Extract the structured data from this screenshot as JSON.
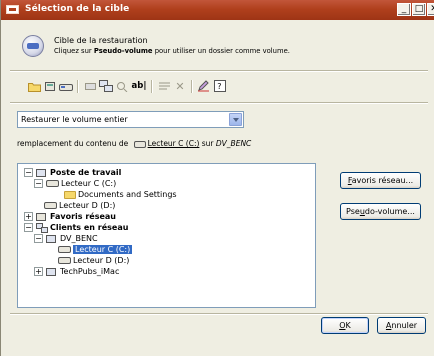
{
  "window": {
    "title": "Sélection de la cible",
    "icon": "window-icon",
    "controls": [
      "minimize",
      "maximize",
      "close"
    ]
  },
  "header": {
    "title": "Cible de la restauration",
    "subtitle_prefix": "Cliquez sur ",
    "subtitle_bold": "Pseudo-volume",
    "subtitle_suffix": " pour utiliser un dossier comme volume."
  },
  "toolbar": {
    "tools": [
      {
        "name": "new-folder-icon",
        "glyph": "📁",
        "enabled": true
      },
      {
        "name": "properties-icon",
        "glyph": "🗂",
        "enabled": true
      },
      {
        "name": "drive-icon",
        "glyph": "🖴",
        "enabled": true
      },
      {
        "name": "map-drive-icon",
        "glyph": "▭",
        "enabled": false
      },
      {
        "name": "network-icon",
        "glyph": "🖧",
        "enabled": true
      },
      {
        "name": "find-icon",
        "glyph": "🔍",
        "enabled": false
      },
      {
        "name": "rename-icon",
        "glyph": "ab|",
        "enabled": true
      },
      {
        "name": "view-icon",
        "glyph": "≡",
        "enabled": false
      },
      {
        "name": "delete-icon",
        "glyph": "✕",
        "enabled": false
      },
      {
        "name": "edit-icon",
        "glyph": "✎",
        "enabled": true
      },
      {
        "name": "help-icon",
        "glyph": "?",
        "enabled": true
      }
    ]
  },
  "restore_mode": {
    "selected": "Restaurer le volume entier"
  },
  "replacement": {
    "prefix": "remplacement du contenu de ",
    "drive": "Lecteur C (C:)",
    "middle": " sur ",
    "machine": "DV_BENC"
  },
  "tree": {
    "nodes": [
      {
        "label": "Poste de travail",
        "expander": "−",
        "bold": true
      },
      {
        "label": "Lecteur C (C:)",
        "expander": "−",
        "bold": false
      },
      {
        "label": "Documents and Settings",
        "expander": "",
        "bold": false
      },
      {
        "label": "Lecteur D (D:)",
        "expander": "",
        "bold": false
      },
      {
        "label": "Favoris réseau",
        "expander": "+",
        "bold": true
      },
      {
        "label": "Clients en réseau",
        "expander": "−",
        "bold": true
      },
      {
        "label": "DV_BENC",
        "expander": "−",
        "bold": false
      },
      {
        "label": "Lecteur C (C:)",
        "expander": "",
        "bold": false,
        "selected": true
      },
      {
        "label": "Lecteur D (D:)",
        "expander": "",
        "bold": false
      },
      {
        "label": "TechPubs_iMac",
        "expander": "+",
        "bold": false
      }
    ]
  },
  "side_buttons": {
    "favorites": {
      "label_pre": "",
      "label_u": "F",
      "label_post": "avoris réseau..."
    },
    "pseudo_volume": {
      "label_pre": "Pse",
      "label_u": "u",
      "label_post": "do-volume..."
    }
  },
  "footer_buttons": {
    "ok": {
      "label_pre": "",
      "label_u": "O",
      "label_post": "K"
    },
    "cancel": {
      "label_pre": "",
      "label_u": "A",
      "label_post": "nnuler"
    }
  },
  "colors": {
    "titlebar": "#b0401d",
    "selection": "#316ac5",
    "dialog_bg": "#efeee2"
  }
}
